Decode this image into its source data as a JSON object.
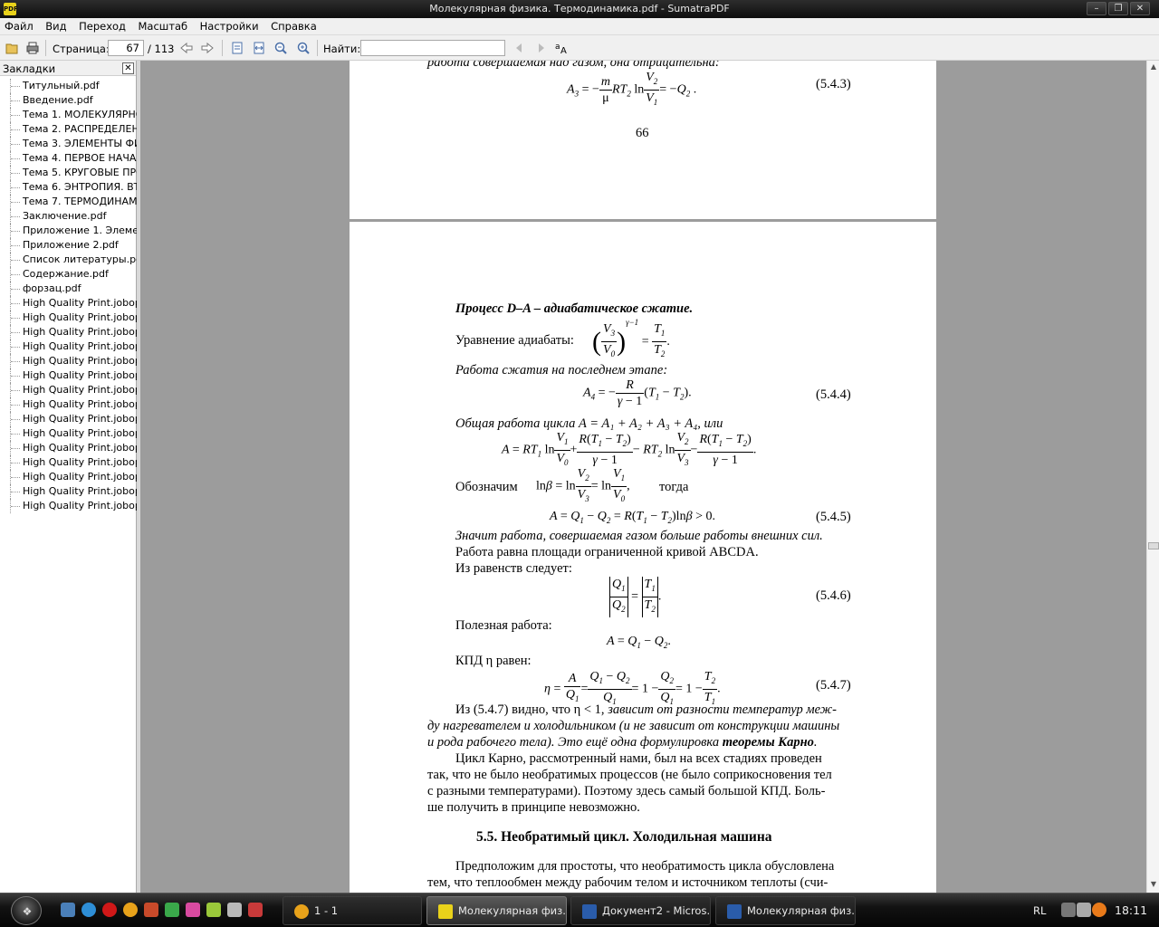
{
  "window": {
    "title": "Молекулярная физика. Термодинамика.pdf - SumatraPDF",
    "app_icon": "SumatraPDF",
    "controls": [
      "minimize",
      "maximize",
      "close"
    ]
  },
  "menu": [
    "Файл",
    "Вид",
    "Переход",
    "Масштаб",
    "Настройки",
    "Справка"
  ],
  "toolbar": {
    "page_label": "Страница:",
    "page_value": "67",
    "page_total": "/ 113",
    "find_label": "Найти:",
    "find_value": ""
  },
  "sidebar": {
    "title": "Закладки",
    "items": [
      "Титульный.pdf",
      "Введение.pdf",
      "Тема 1. МОЛЕКУЛЯРНО-",
      "Тема 2. РАСПРЕДЕЛЕНИ",
      "Тема 3. ЭЛЕМЕНТЫ ФИЗ",
      "Тема 4. ПЕРВОЕ НАЧАЛ",
      "Тема 5.  КРУГОВЫЕ ПРО",
      "Тема 6. ЭНТРОПИЯ. ВТО",
      "Тема 7. ТЕРМОДИНАМИ",
      "Заключение.pdf",
      "Приложение 1. Элемен",
      "Приложение 2.pdf",
      "Список литературы.pdf",
      "Содержание.pdf",
      "форзац.pdf",
      "High Quality Print.jobop",
      "High Quality Print.jobop",
      "High Quality Print.jobop",
      "High Quality Print.jobop",
      "High Quality Print.jobop",
      "High Quality Print.jobop",
      "High Quality Print.jobop",
      "High Quality Print.jobop",
      "High Quality Print.jobop",
      "High Quality Print.jobop",
      "High Quality Print.jobop",
      "High Quality Print.jobop",
      "High Quality Print.jobop",
      "High Quality Print.jobop",
      "High Quality Print.jobop"
    ]
  },
  "document": {
    "page66": {
      "top_line": "работа совершаемая над газом, она отрицательна:",
      "eq_543": "(5.4.3)",
      "page_number": "66"
    },
    "page67": {
      "heading_bold": "Процесс D–A",
      "heading_rest": " – адиабатическое сжатие.",
      "adiabat_label": "Уравнение адиабаты:",
      "work_last_stage": "Работа сжатия на последнем этапе:",
      "eq_544": "(5.4.4)",
      "total_work": "Общая работа цикла A = A₁ + A₂ + A₃ + A₄, или",
      "denote": "Обозначим",
      "then": "тогда",
      "eq_545": "(5.4.5)",
      "means": "Значит работа, совершаемая газом больше работы внешних сил.",
      "area": "Работа равна площади ограниченной кривой ABCDA.",
      "from_eq": "Из равенств следует:",
      "eq_546": "(5.4.6)",
      "useful": "Полезная работа:",
      "eff_label": "КПД η равен:",
      "eq_547": "(5.4.7)",
      "p1_l1_a": "Из (5.4.7) видно, что  η < 1,",
      "p1_l1_b": " зависит от разности температур меж-",
      "p1_l2": "ду нагревателем и холодильником (и не зависит от конструкции машины",
      "p1_l3_a": "и рода рабочего тела). Это ещё одна формулировка ",
      "p1_l3_b": "теоремы Карно",
      "p2_l1": "Цикл Карно, рассмотренный нами, был на всех стадиях проведен",
      "p2_l2": "так, что не было необратимых процессов (не было соприкосновения тел",
      "p2_l3": "с разными температурами). Поэтому здесь самый большой КПД. Боль-",
      "p2_l4": "ше получить в принципе невозможно.",
      "section": "5.5. Необратимый цикл. Холодильная машина",
      "p3_l1": "Предположим для простоты, что необратимость цикла обусловлена",
      "p3_l2": "тем, что теплообмен между рабочим телом и источником теплоты (счи-"
    }
  },
  "taskbar": {
    "tasks": [
      {
        "label": "1 - 1",
        "icon": "aimp-icon",
        "color": "#e8a21a"
      },
      {
        "label": "Молекулярная физ...",
        "icon": "sumatra-icon",
        "color": "#e9d21a",
        "active": true
      },
      {
        "label": "Документ2 - Micros...",
        "icon": "word-icon",
        "color": "#2a5caa"
      },
      {
        "label": "Молекулярная физ...",
        "icon": "word-icon",
        "color": "#2a5caa"
      }
    ],
    "lang": "RL",
    "clock": "18:11"
  }
}
